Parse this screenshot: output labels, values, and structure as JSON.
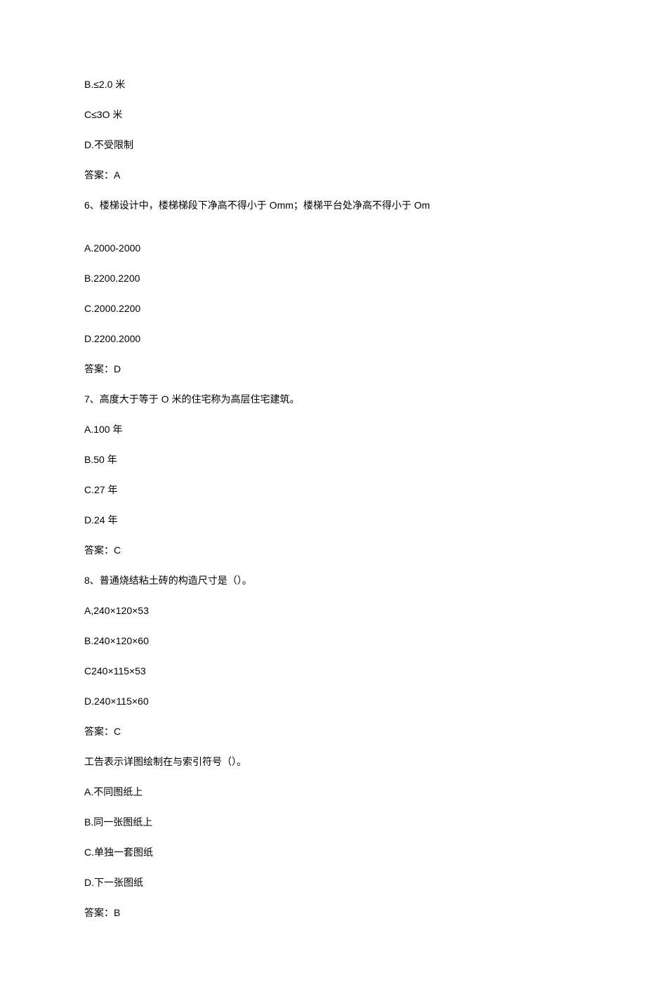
{
  "q5": {
    "optB": "B.≤2.0 米",
    "optC": "C≤3O 米",
    "optD": "D.不受限制",
    "answer": "答案：A"
  },
  "q6": {
    "stem": "6、楼梯设计中，楼梯梯段下净高不得小于 Omm；楼梯平台处净高不得小于 Om",
    "optA": "A.2000-2000",
    "optB": "B.2200.2200",
    "optC": "C.2000.2200",
    "optD": "D.2200.2000",
    "answer": "答案：D"
  },
  "q7": {
    "stem": "7、高度大于等于 O 米的住宅称为高层住宅建筑。",
    "optA": "A.100 年",
    "optB": "B.50 年",
    "optC": "C.27 年",
    "optD": "D.24 年",
    "answer": "答案：C"
  },
  "q8": {
    "stem": "8、普通烧结粘土砖的构造尺寸是（）。",
    "optA": "A,240×120×53",
    "optB": "B.240×120×60",
    "optC": "C240×115×53",
    "optD": "D.240×115×60",
    "answer": "答案：C"
  },
  "q9": {
    "stem": "工告表示详图绘制在与索引符号（）。",
    "optA": "A.不同图纸上",
    "optB": "B.同一张图纸上",
    "optC": "C.单独一套图纸",
    "optD": "D.下一张图纸",
    "answer": "答案：B"
  }
}
